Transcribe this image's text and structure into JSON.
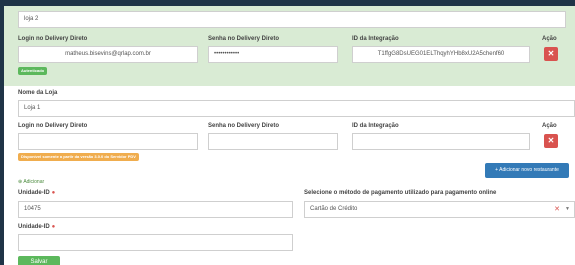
{
  "store1": {
    "name_value": "loja 2",
    "login_label": "Login no Delivery Direto",
    "login_value": "matheus.bisevins@qrlap.com.br",
    "login_badge": "Autenticado",
    "password_label": "Senha no Delivery Direto",
    "password_value": "••••••••••••",
    "integration_label": "ID da Integração",
    "integration_value": "T1ffgG8DsUEG01ELThqyhYHb8xU2A5chenf60",
    "action_label": "Ação"
  },
  "store2": {
    "name_label": "Nome da Loja",
    "name_value": "Loja 1",
    "login_label": "Login no Delivery Direto",
    "password_label": "Senha no Delivery Direto",
    "integration_label": "ID da Integração",
    "action_label": "Ação",
    "warning_badge": "Disponível somente a partir da versão 3.0.0 do Servidor PDV"
  },
  "actions": {
    "add_store_label": "+ Adicionar novo restaurante",
    "add_unit_label": "Adicionar",
    "save_label": "Salvar"
  },
  "unit": {
    "unit_id_label": "Unidade-ID",
    "unit_id_value": "10475",
    "payment_label": "Selecione o método de pagamento utilizado para pagamento online",
    "payment_value": "Cartão de Crédito",
    "unit_id2_label": "Unidade-ID",
    "unit_id2_value": ""
  },
  "colors": {
    "panel_green": "#d9ebd4",
    "delete_red": "#d9534f",
    "badge_green": "#5cb85c",
    "badge_orange": "#f0ad4e",
    "button_blue": "#337ab7",
    "background_dark": "#1f3447"
  }
}
